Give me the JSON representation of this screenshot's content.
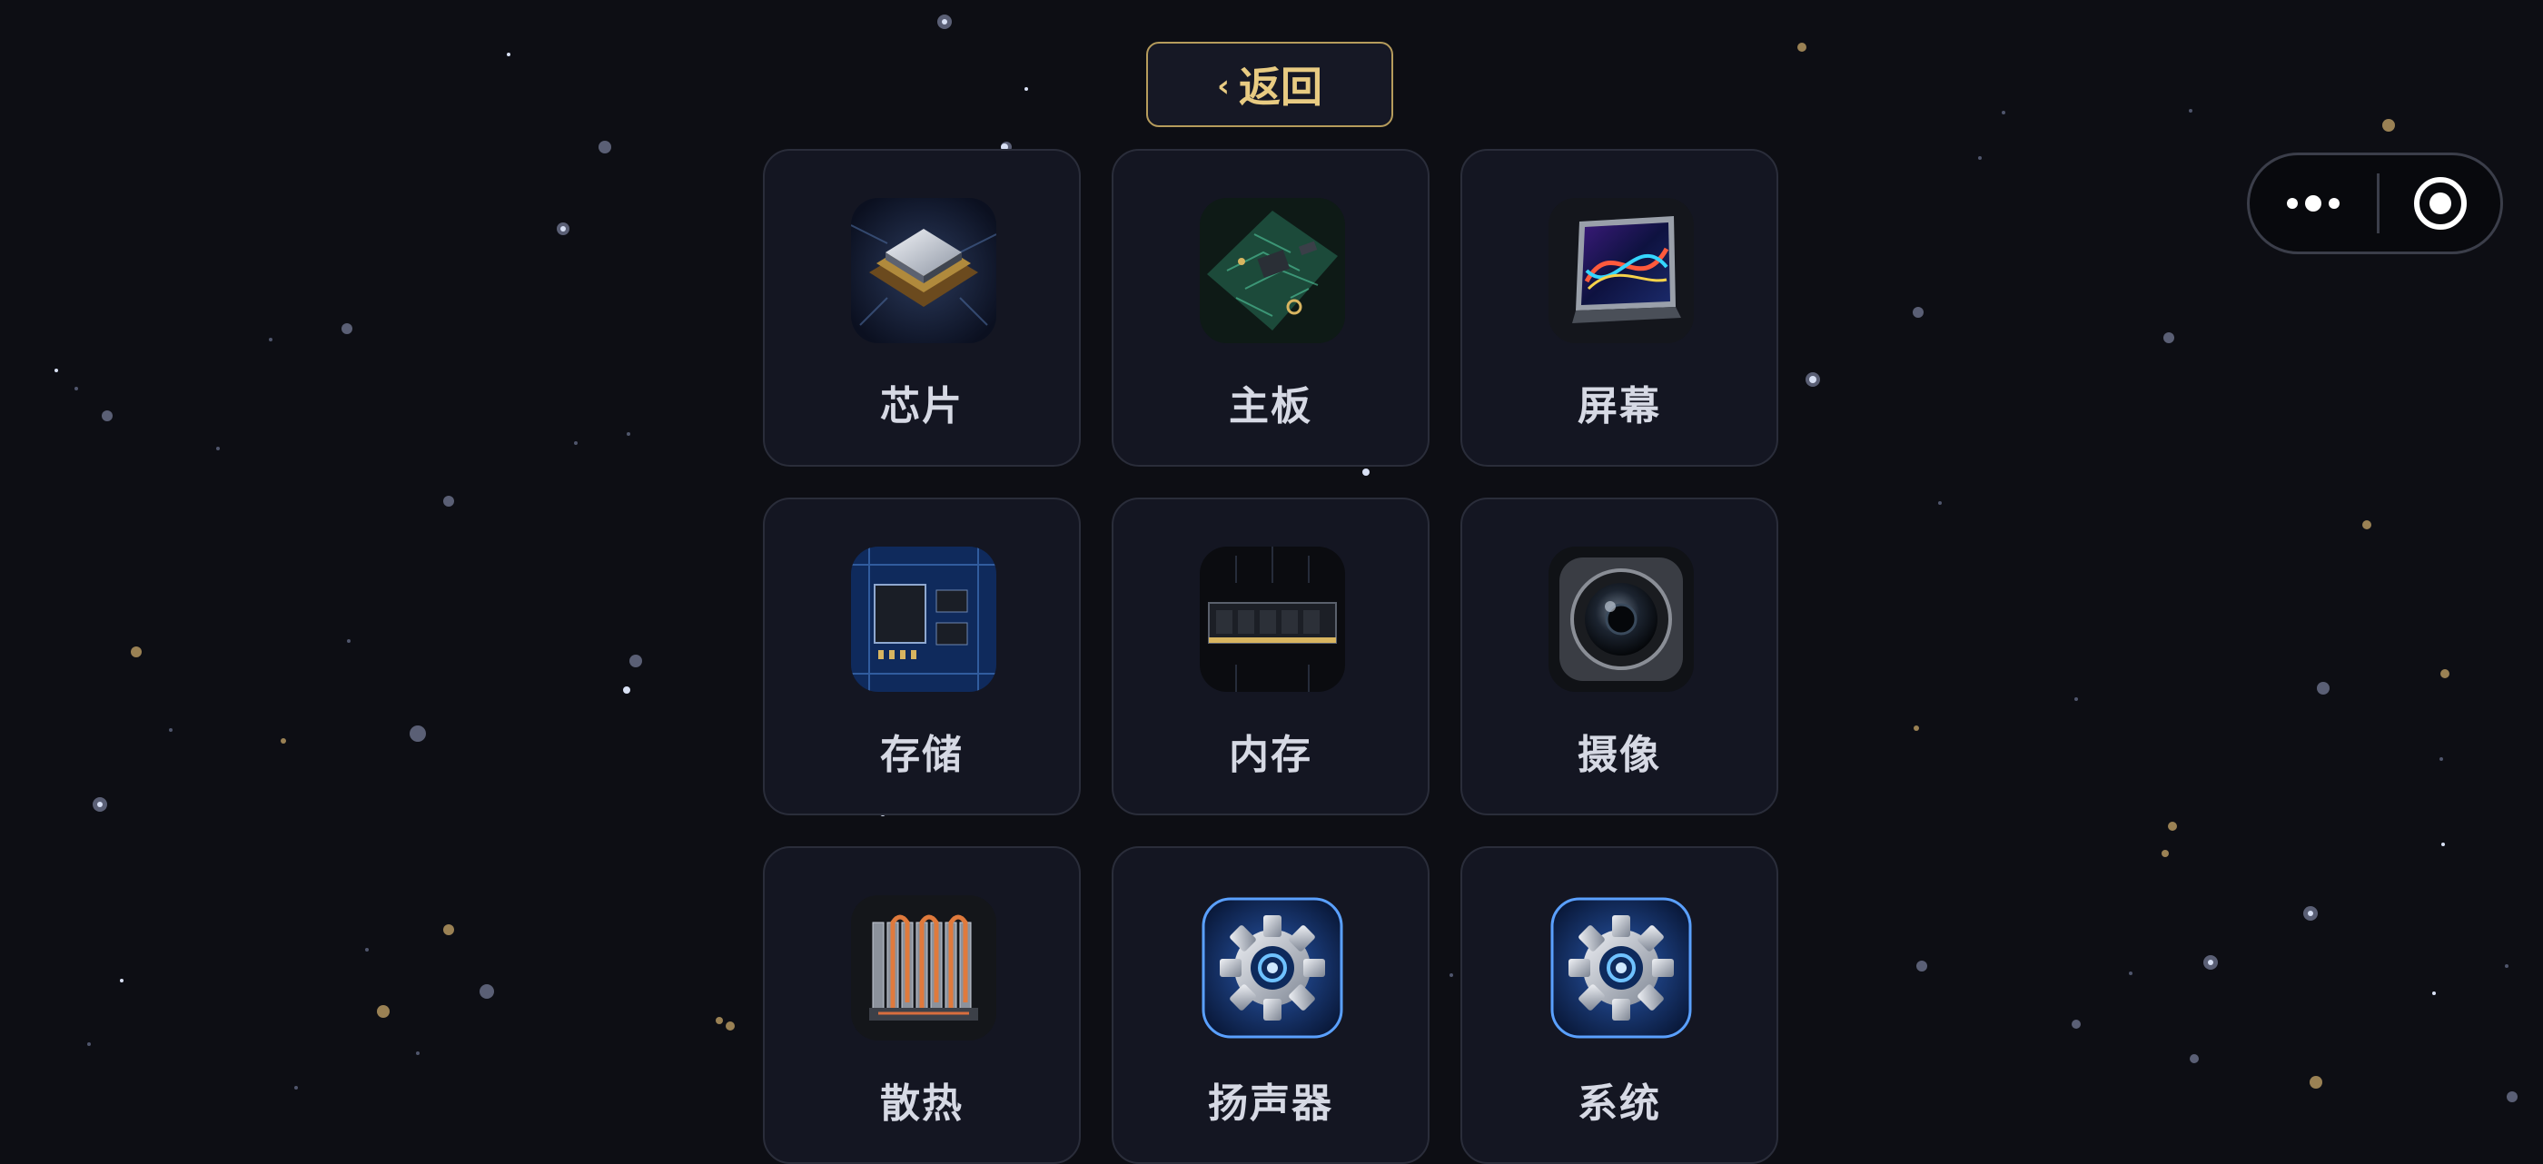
{
  "nav": {
    "back_chevron": "‹",
    "back_label": "返回"
  },
  "capsule": {
    "more_icon": "more-dots-icon",
    "close_icon": "target-circle-icon"
  },
  "categories": [
    {
      "label": "芯片",
      "icon": "chip-icon"
    },
    {
      "label": "主板",
      "icon": "motherboard-icon"
    },
    {
      "label": "屏幕",
      "icon": "screen-icon"
    },
    {
      "label": "存储",
      "icon": "storage-icon"
    },
    {
      "label": "内存",
      "icon": "memory-icon"
    },
    {
      "label": "摄像",
      "icon": "camera-icon"
    },
    {
      "label": "散热",
      "icon": "cooling-icon"
    },
    {
      "label": "扬声器",
      "icon": "speaker-gear-icon"
    },
    {
      "label": "系统",
      "icon": "system-gear-icon"
    }
  ],
  "colors": {
    "background": "#0d0e14",
    "card": "#141622",
    "accent_gold": "#e8cb82",
    "label": "#d6d9e4"
  }
}
